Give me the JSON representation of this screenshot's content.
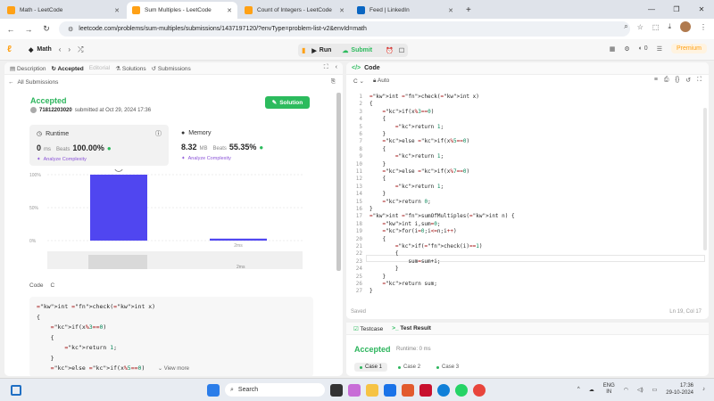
{
  "browser": {
    "tabs": [
      {
        "title": "Math - LeetCode",
        "active": false,
        "favicon_color": "#ffa116"
      },
      {
        "title": "Sum Multiples - LeetCode",
        "active": true,
        "favicon_color": "#ffa116"
      },
      {
        "title": "Count of Integers - LeetCode",
        "active": false,
        "favicon_color": "#ffa116"
      },
      {
        "title": "Feed | LinkedIn",
        "active": false,
        "favicon_color": "#0a66c2"
      }
    ],
    "new_tab_label": "+",
    "url": "leetcode.com/problems/sum-multiples/submissions/1437197120/?envType=problem-list-v2&envId=math"
  },
  "toolbar": {
    "problem_list": "Math",
    "run_label": "Run",
    "submit_label": "Submit",
    "streak": "0",
    "premium_label": "Premium"
  },
  "left": {
    "tabs": [
      {
        "label": "Description"
      },
      {
        "label": "Accepted"
      },
      {
        "label": "Editorial"
      },
      {
        "label": "Solutions"
      },
      {
        "label": "Submissions"
      }
    ],
    "all_submissions": "All Submissions",
    "status": "Accepted",
    "username": "71812203020",
    "submitted_at": "submitted at Oct 29, 2024 17:36",
    "solution_label": "Solution",
    "runtime": {
      "label": "Runtime",
      "value": "0",
      "unit": "ms",
      "beats_label": "Beats",
      "beats": "100.00%",
      "analyze": "Analyze Complexity"
    },
    "memory": {
      "label": "Memory",
      "value": "8.32",
      "unit": "MB",
      "beats_label": "Beats",
      "beats": "55.35%",
      "analyze": "Analyze Complexity"
    },
    "code_label": "Code",
    "code_lang": "C",
    "code_preview": [
      "int check(int x)",
      "{",
      "    if(x%3==0)",
      "    {",
      "        return 1;",
      "    }",
      "    else if(x%5==0)",
      "    {"
    ],
    "view_more": "View more"
  },
  "chart_data": {
    "type": "bar",
    "categories": [
      "",
      "2ms"
    ],
    "values": [
      100,
      3
    ],
    "y_ticks": [
      "100%",
      "50%",
      "0%"
    ],
    "ylim": [
      0,
      100
    ],
    "range_label": "2ms",
    "bar_color": "#5046f0"
  },
  "editor": {
    "header": "Code",
    "lang": "C",
    "mode": "Auto",
    "lines": [
      "int check(int x)",
      "{",
      "    if(x%3==0)",
      "    {",
      "        return 1;",
      "    }",
      "    else if(x%5==0)",
      "    {",
      "        return 1;",
      "    }",
      "    else if(x%7==0)",
      "    {",
      "        return 1;",
      "    }",
      "    return 0;",
      "}",
      "int sumOfMultiples(int n) {",
      "    int i,sum=0;",
      "    for(i=0;i<=n;i++)",
      "    {",
      "        if(check(i)==1)",
      "        {",
      "            sum=sum+i;",
      "        }",
      "    }",
      "    return sum;",
      "}"
    ],
    "saved": "Saved",
    "cursor": "Ln 19, Col 17"
  },
  "testpanel": {
    "testcase_tab": "Testcase",
    "result_tab": "Test Result",
    "status": "Accepted",
    "runtime": "Runtime: 0 ms",
    "cases": [
      "Case 1",
      "Case 2",
      "Case 3"
    ]
  },
  "taskbar": {
    "search": "Search",
    "lang_top": "ENG",
    "lang_bottom": "IN",
    "time": "17:36",
    "date": "29-10-2024"
  }
}
